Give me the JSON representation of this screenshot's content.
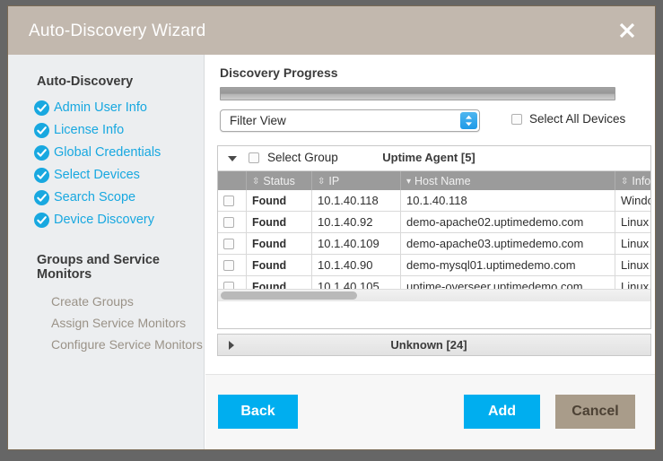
{
  "window": {
    "title": "Auto-Discovery Wizard",
    "close_icon": "close-icon"
  },
  "sidebar": {
    "section_1_title": "Auto-Discovery",
    "steps": [
      {
        "label": "Admin User Info",
        "icon": "check-circle-icon",
        "state": "complete"
      },
      {
        "label": "License Info",
        "icon": "check-circle-icon",
        "state": "complete"
      },
      {
        "label": "Global Credentials",
        "icon": "check-circle-icon",
        "state": "complete"
      },
      {
        "label": "Select Devices",
        "icon": "check-circle-icon",
        "state": "complete"
      },
      {
        "label": "Search Scope",
        "icon": "check-circle-icon",
        "state": "complete"
      },
      {
        "label": "Device Discovery",
        "icon": "check-circle-icon",
        "state": "complete"
      }
    ],
    "section_2_title": "Groups and Service Monitors",
    "substeps": [
      {
        "label": "Create Groups"
      },
      {
        "label": "Assign Service Monitors"
      },
      {
        "label": "Configure Service Monitors"
      }
    ]
  },
  "main": {
    "progress_label": "Discovery Progress",
    "progress_percent": 100,
    "filter": {
      "value": "Filter View",
      "arrow_icon": "chevron-updown-icon"
    },
    "select_all": {
      "label": "Select All Devices",
      "checked": false
    },
    "group_header": {
      "caret_icon": "caret-down-icon",
      "select_group_label": "Select Group",
      "select_group_checked": false,
      "group_title": "Uptime Agent [5]"
    },
    "columns": [
      {
        "label": "",
        "sort_icon": ""
      },
      {
        "label": "Status",
        "sort_icon": "sort-updown-icon"
      },
      {
        "label": "IP",
        "sort_icon": "sort-updown-icon"
      },
      {
        "label": "Host Name",
        "sort_icon": "sort-desc-icon"
      },
      {
        "label": "Info",
        "sort_icon": "sort-updown-icon"
      }
    ],
    "rows": [
      {
        "checked": false,
        "status": "Found",
        "ip": "10.1.40.118",
        "host": "10.1.40.118",
        "info": "Windows_"
      },
      {
        "checked": false,
        "status": "Found",
        "ip": "10.1.40.92",
        "host": "demo-apache02.uptimedemo.com",
        "info": "Linux dem"
      },
      {
        "checked": false,
        "status": "Found",
        "ip": "10.1.40.109",
        "host": "demo-apache03.uptimedemo.com",
        "info": "Linux dem"
      },
      {
        "checked": false,
        "status": "Found",
        "ip": "10.1.40.90",
        "host": "demo-mysql01.uptimedemo.com",
        "info": "Linux dem"
      },
      {
        "checked": false,
        "status": "Found",
        "ip": "10.1.40.105",
        "host": "uptime-overseer.uptimedemo.com",
        "info": "Linux upt"
      }
    ],
    "unknown_group": {
      "caret_icon": "caret-right-icon",
      "title": "Unknown [24]"
    }
  },
  "footer": {
    "back_label": "Back",
    "add_label": "Add",
    "cancel_label": "Cancel"
  },
  "colors": {
    "accent_blue": "#00aeef",
    "status_green": "#8cc63e",
    "cancel_tan": "#a99c8a",
    "titlebar": "#c2b8ae",
    "sidebar_bg": "#eceef0",
    "header_gray": "#9b9b9b"
  }
}
